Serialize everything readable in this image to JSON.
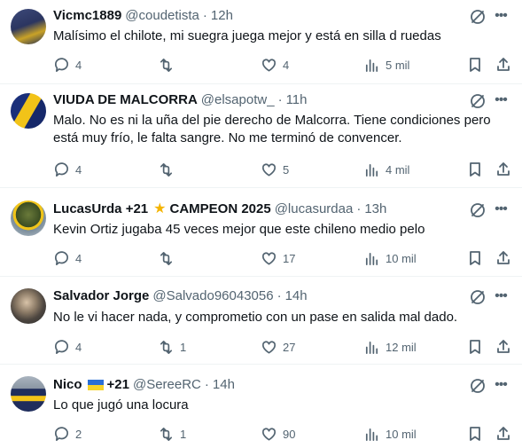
{
  "colors": {
    "text": "#0f1419",
    "muted": "#536471",
    "divider": "#eff3f4"
  },
  "tweets": [
    {
      "name": "Vicmc1889",
      "handle": "@coudetista",
      "time": "12h",
      "text": "Malísimo el chilote, mi suegra juega mejor y está en silla d ruedas",
      "replies": "4",
      "retweets": "",
      "likes": "4",
      "views": "5 mil"
    },
    {
      "name": "VIUDA DE MALCORRA",
      "handle": "@elsapotw_",
      "time": "11h",
      "text": "Malo. No es ni la uña del pie derecho de Malcorra. Tiene condiciones pero está muy frío, le falta sangre. No me terminó de convencer.",
      "replies": "4",
      "retweets": "",
      "likes": "5",
      "views": "4 mil"
    },
    {
      "name": "LucasUrda +21",
      "name_suffix": "CAMPEON 2025",
      "badge_icon": "star-icon",
      "handle": "@lucasurdaa",
      "time": "13h",
      "text": "Kevin Ortiz jugaba 45 veces mejor que este chileno medio pelo",
      "replies": "4",
      "retweets": "",
      "likes": "17",
      "views": "10 mil"
    },
    {
      "name": "Salvador Jorge",
      "handle": "@Salvado96043056",
      "time": "14h",
      "text": "No le vi hacer nada, y comprometio con un pase en salida mal dado.",
      "replies": "4",
      "retweets": "1",
      "likes": "27",
      "views": "12 mil"
    },
    {
      "name": "Nico",
      "name_suffix": "+21",
      "badge_icon": "ukraine-flag-icon",
      "handle": "@SereeRC",
      "time": "14h",
      "text": "Lo que jugó una locura",
      "replies": "2",
      "retweets": "1",
      "likes": "90",
      "views": "10 mil"
    }
  ]
}
